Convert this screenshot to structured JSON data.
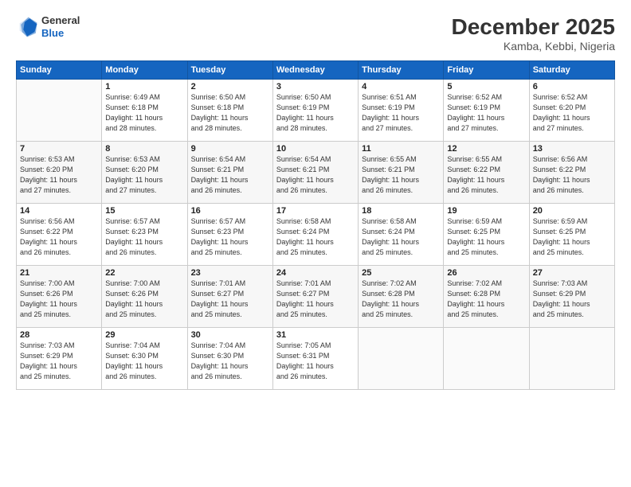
{
  "header": {
    "logo_general": "General",
    "logo_blue": "Blue",
    "title": "December 2025",
    "subtitle": "Kamba, Kebbi, Nigeria"
  },
  "weekdays": [
    "Sunday",
    "Monday",
    "Tuesday",
    "Wednesday",
    "Thursday",
    "Friday",
    "Saturday"
  ],
  "weeks": [
    [
      {
        "day": "",
        "info": ""
      },
      {
        "day": "1",
        "info": "Sunrise: 6:49 AM\nSunset: 6:18 PM\nDaylight: 11 hours\nand 28 minutes."
      },
      {
        "day": "2",
        "info": "Sunrise: 6:50 AM\nSunset: 6:18 PM\nDaylight: 11 hours\nand 28 minutes."
      },
      {
        "day": "3",
        "info": "Sunrise: 6:50 AM\nSunset: 6:19 PM\nDaylight: 11 hours\nand 28 minutes."
      },
      {
        "day": "4",
        "info": "Sunrise: 6:51 AM\nSunset: 6:19 PM\nDaylight: 11 hours\nand 27 minutes."
      },
      {
        "day": "5",
        "info": "Sunrise: 6:52 AM\nSunset: 6:19 PM\nDaylight: 11 hours\nand 27 minutes."
      },
      {
        "day": "6",
        "info": "Sunrise: 6:52 AM\nSunset: 6:20 PM\nDaylight: 11 hours\nand 27 minutes."
      }
    ],
    [
      {
        "day": "7",
        "info": "Sunrise: 6:53 AM\nSunset: 6:20 PM\nDaylight: 11 hours\nand 27 minutes."
      },
      {
        "day": "8",
        "info": "Sunrise: 6:53 AM\nSunset: 6:20 PM\nDaylight: 11 hours\nand 27 minutes."
      },
      {
        "day": "9",
        "info": "Sunrise: 6:54 AM\nSunset: 6:21 PM\nDaylight: 11 hours\nand 26 minutes."
      },
      {
        "day": "10",
        "info": "Sunrise: 6:54 AM\nSunset: 6:21 PM\nDaylight: 11 hours\nand 26 minutes."
      },
      {
        "day": "11",
        "info": "Sunrise: 6:55 AM\nSunset: 6:21 PM\nDaylight: 11 hours\nand 26 minutes."
      },
      {
        "day": "12",
        "info": "Sunrise: 6:55 AM\nSunset: 6:22 PM\nDaylight: 11 hours\nand 26 minutes."
      },
      {
        "day": "13",
        "info": "Sunrise: 6:56 AM\nSunset: 6:22 PM\nDaylight: 11 hours\nand 26 minutes."
      }
    ],
    [
      {
        "day": "14",
        "info": "Sunrise: 6:56 AM\nSunset: 6:22 PM\nDaylight: 11 hours\nand 26 minutes."
      },
      {
        "day": "15",
        "info": "Sunrise: 6:57 AM\nSunset: 6:23 PM\nDaylight: 11 hours\nand 26 minutes."
      },
      {
        "day": "16",
        "info": "Sunrise: 6:57 AM\nSunset: 6:23 PM\nDaylight: 11 hours\nand 25 minutes."
      },
      {
        "day": "17",
        "info": "Sunrise: 6:58 AM\nSunset: 6:24 PM\nDaylight: 11 hours\nand 25 minutes."
      },
      {
        "day": "18",
        "info": "Sunrise: 6:58 AM\nSunset: 6:24 PM\nDaylight: 11 hours\nand 25 minutes."
      },
      {
        "day": "19",
        "info": "Sunrise: 6:59 AM\nSunset: 6:25 PM\nDaylight: 11 hours\nand 25 minutes."
      },
      {
        "day": "20",
        "info": "Sunrise: 6:59 AM\nSunset: 6:25 PM\nDaylight: 11 hours\nand 25 minutes."
      }
    ],
    [
      {
        "day": "21",
        "info": "Sunrise: 7:00 AM\nSunset: 6:26 PM\nDaylight: 11 hours\nand 25 minutes."
      },
      {
        "day": "22",
        "info": "Sunrise: 7:00 AM\nSunset: 6:26 PM\nDaylight: 11 hours\nand 25 minutes."
      },
      {
        "day": "23",
        "info": "Sunrise: 7:01 AM\nSunset: 6:27 PM\nDaylight: 11 hours\nand 25 minutes."
      },
      {
        "day": "24",
        "info": "Sunrise: 7:01 AM\nSunset: 6:27 PM\nDaylight: 11 hours\nand 25 minutes."
      },
      {
        "day": "25",
        "info": "Sunrise: 7:02 AM\nSunset: 6:28 PM\nDaylight: 11 hours\nand 25 minutes."
      },
      {
        "day": "26",
        "info": "Sunrise: 7:02 AM\nSunset: 6:28 PM\nDaylight: 11 hours\nand 25 minutes."
      },
      {
        "day": "27",
        "info": "Sunrise: 7:03 AM\nSunset: 6:29 PM\nDaylight: 11 hours\nand 25 minutes."
      }
    ],
    [
      {
        "day": "28",
        "info": "Sunrise: 7:03 AM\nSunset: 6:29 PM\nDaylight: 11 hours\nand 25 minutes."
      },
      {
        "day": "29",
        "info": "Sunrise: 7:04 AM\nSunset: 6:30 PM\nDaylight: 11 hours\nand 26 minutes."
      },
      {
        "day": "30",
        "info": "Sunrise: 7:04 AM\nSunset: 6:30 PM\nDaylight: 11 hours\nand 26 minutes."
      },
      {
        "day": "31",
        "info": "Sunrise: 7:05 AM\nSunset: 6:31 PM\nDaylight: 11 hours\nand 26 minutes."
      },
      {
        "day": "",
        "info": ""
      },
      {
        "day": "",
        "info": ""
      },
      {
        "day": "",
        "info": ""
      }
    ]
  ]
}
